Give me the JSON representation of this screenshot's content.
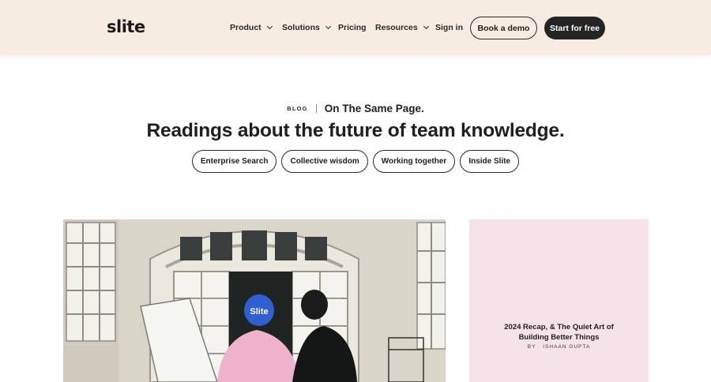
{
  "nav": {
    "logo": "slite",
    "items": [
      {
        "label": "Product",
        "dropdown": true
      },
      {
        "label": "Solutions",
        "dropdown": true
      },
      {
        "label": "Pricing",
        "dropdown": false
      },
      {
        "label": "Resources",
        "dropdown": true
      }
    ],
    "sign_in": "Sign in",
    "demo_button": "Book a demo",
    "cta_button": "Start for free"
  },
  "hero": {
    "eyebrow_tag": "BLOG",
    "tagline": "On The Same Page.",
    "headline": "Readings about the future of team knowledge.",
    "categories": [
      "Enterprise Search",
      "Collective wisdom",
      "Working together",
      "Inside Slite"
    ]
  },
  "featured_card": {
    "title": "2024 Recap, & The Quiet Art of Building Better Things",
    "by_label": "BY",
    "author": "ISHAAN GUPTA"
  },
  "colors": {
    "nav_bg": "#f7ece2",
    "card_bg": "#f6e3ea",
    "dark_button": "#242424"
  },
  "photo": {
    "cap_text": "Slite"
  }
}
